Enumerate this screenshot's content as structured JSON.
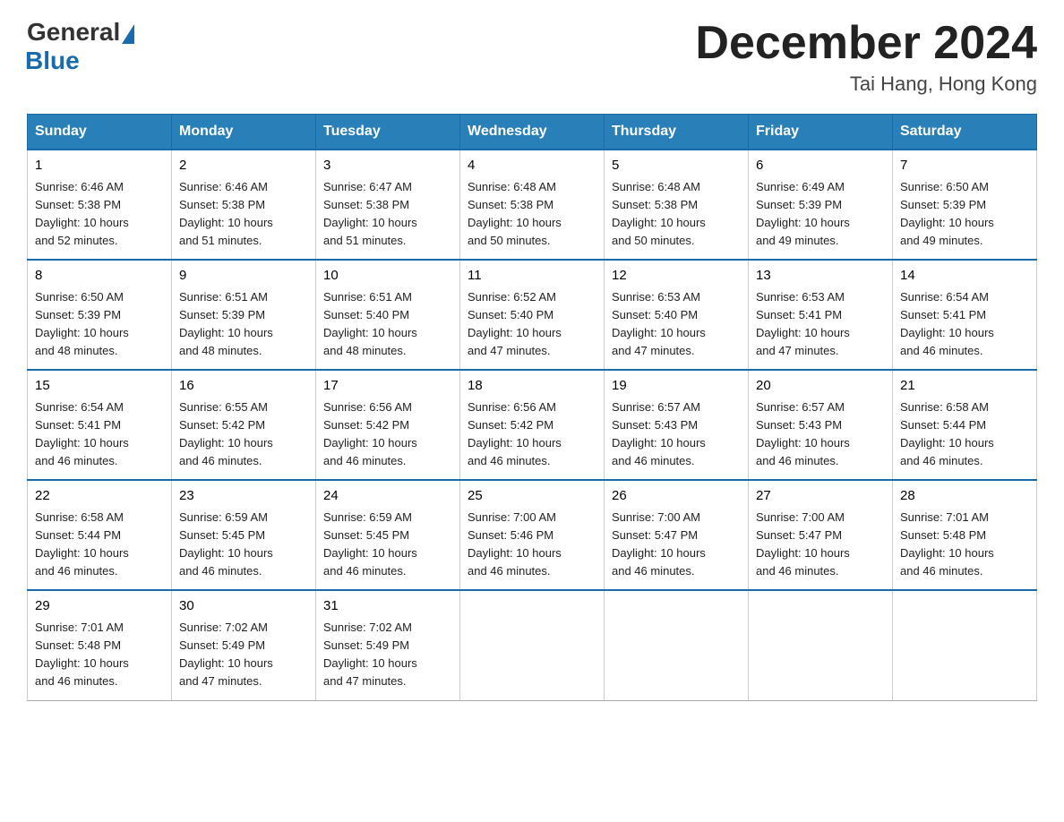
{
  "logo": {
    "general": "General",
    "blue": "Blue"
  },
  "title": "December 2024",
  "location": "Tai Hang, Hong Kong",
  "header_color": "#2980b9",
  "days_of_week": [
    "Sunday",
    "Monday",
    "Tuesday",
    "Wednesday",
    "Thursday",
    "Friday",
    "Saturday"
  ],
  "weeks": [
    [
      {
        "day": "1",
        "sunrise": "6:46 AM",
        "sunset": "5:38 PM",
        "daylight": "10 hours and 52 minutes."
      },
      {
        "day": "2",
        "sunrise": "6:46 AM",
        "sunset": "5:38 PM",
        "daylight": "10 hours and 51 minutes."
      },
      {
        "day": "3",
        "sunrise": "6:47 AM",
        "sunset": "5:38 PM",
        "daylight": "10 hours and 51 minutes."
      },
      {
        "day": "4",
        "sunrise": "6:48 AM",
        "sunset": "5:38 PM",
        "daylight": "10 hours and 50 minutes."
      },
      {
        "day": "5",
        "sunrise": "6:48 AM",
        "sunset": "5:38 PM",
        "daylight": "10 hours and 50 minutes."
      },
      {
        "day": "6",
        "sunrise": "6:49 AM",
        "sunset": "5:39 PM",
        "daylight": "10 hours and 49 minutes."
      },
      {
        "day": "7",
        "sunrise": "6:50 AM",
        "sunset": "5:39 PM",
        "daylight": "10 hours and 49 minutes."
      }
    ],
    [
      {
        "day": "8",
        "sunrise": "6:50 AM",
        "sunset": "5:39 PM",
        "daylight": "10 hours and 48 minutes."
      },
      {
        "day": "9",
        "sunrise": "6:51 AM",
        "sunset": "5:39 PM",
        "daylight": "10 hours and 48 minutes."
      },
      {
        "day": "10",
        "sunrise": "6:51 AM",
        "sunset": "5:40 PM",
        "daylight": "10 hours and 48 minutes."
      },
      {
        "day": "11",
        "sunrise": "6:52 AM",
        "sunset": "5:40 PM",
        "daylight": "10 hours and 47 minutes."
      },
      {
        "day": "12",
        "sunrise": "6:53 AM",
        "sunset": "5:40 PM",
        "daylight": "10 hours and 47 minutes."
      },
      {
        "day": "13",
        "sunrise": "6:53 AM",
        "sunset": "5:41 PM",
        "daylight": "10 hours and 47 minutes."
      },
      {
        "day": "14",
        "sunrise": "6:54 AM",
        "sunset": "5:41 PM",
        "daylight": "10 hours and 46 minutes."
      }
    ],
    [
      {
        "day": "15",
        "sunrise": "6:54 AM",
        "sunset": "5:41 PM",
        "daylight": "10 hours and 46 minutes."
      },
      {
        "day": "16",
        "sunrise": "6:55 AM",
        "sunset": "5:42 PM",
        "daylight": "10 hours and 46 minutes."
      },
      {
        "day": "17",
        "sunrise": "6:56 AM",
        "sunset": "5:42 PM",
        "daylight": "10 hours and 46 minutes."
      },
      {
        "day": "18",
        "sunrise": "6:56 AM",
        "sunset": "5:42 PM",
        "daylight": "10 hours and 46 minutes."
      },
      {
        "day": "19",
        "sunrise": "6:57 AM",
        "sunset": "5:43 PM",
        "daylight": "10 hours and 46 minutes."
      },
      {
        "day": "20",
        "sunrise": "6:57 AM",
        "sunset": "5:43 PM",
        "daylight": "10 hours and 46 minutes."
      },
      {
        "day": "21",
        "sunrise": "6:58 AM",
        "sunset": "5:44 PM",
        "daylight": "10 hours and 46 minutes."
      }
    ],
    [
      {
        "day": "22",
        "sunrise": "6:58 AM",
        "sunset": "5:44 PM",
        "daylight": "10 hours and 46 minutes."
      },
      {
        "day": "23",
        "sunrise": "6:59 AM",
        "sunset": "5:45 PM",
        "daylight": "10 hours and 46 minutes."
      },
      {
        "day": "24",
        "sunrise": "6:59 AM",
        "sunset": "5:45 PM",
        "daylight": "10 hours and 46 minutes."
      },
      {
        "day": "25",
        "sunrise": "7:00 AM",
        "sunset": "5:46 PM",
        "daylight": "10 hours and 46 minutes."
      },
      {
        "day": "26",
        "sunrise": "7:00 AM",
        "sunset": "5:47 PM",
        "daylight": "10 hours and 46 minutes."
      },
      {
        "day": "27",
        "sunrise": "7:00 AM",
        "sunset": "5:47 PM",
        "daylight": "10 hours and 46 minutes."
      },
      {
        "day": "28",
        "sunrise": "7:01 AM",
        "sunset": "5:48 PM",
        "daylight": "10 hours and 46 minutes."
      }
    ],
    [
      {
        "day": "29",
        "sunrise": "7:01 AM",
        "sunset": "5:48 PM",
        "daylight": "10 hours and 46 minutes."
      },
      {
        "day": "30",
        "sunrise": "7:02 AM",
        "sunset": "5:49 PM",
        "daylight": "10 hours and 47 minutes."
      },
      {
        "day": "31",
        "sunrise": "7:02 AM",
        "sunset": "5:49 PM",
        "daylight": "10 hours and 47 minutes."
      },
      null,
      null,
      null,
      null
    ]
  ],
  "labels": {
    "sunrise": "Sunrise: ",
    "sunset": "Sunset: ",
    "daylight": "Daylight: "
  }
}
